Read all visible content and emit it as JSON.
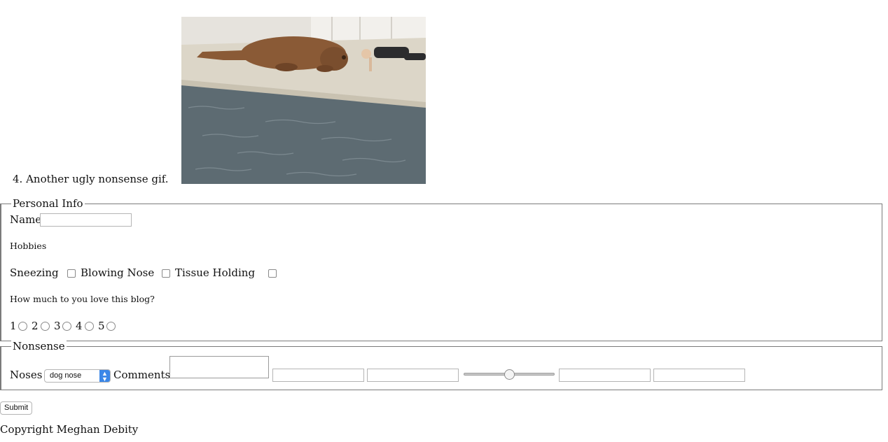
{
  "list_item": {
    "number": "4.",
    "caption": "Another ugly nonsense gif."
  },
  "personal": {
    "legend": "Personal Info",
    "name_label": "Name",
    "name_value": "",
    "hobbies_heading": "Hobbies",
    "hobbies": [
      {
        "label": "Sneezing",
        "checked": false
      },
      {
        "label": "Blowing Nose",
        "checked": false
      },
      {
        "label": "Tissue Holding",
        "checked": false
      }
    ],
    "love_question": "How much to you love this blog?",
    "ratings": [
      "1",
      "2",
      "3",
      "4",
      "5"
    ]
  },
  "nonsense": {
    "legend": "Nonsense",
    "noses_label": "Noses",
    "noses_selected": "dog nose",
    "comments_label": "Comments",
    "slider_value": 0.5
  },
  "submit_label": "Submit",
  "copyright": "Copyright Meghan Debity"
}
